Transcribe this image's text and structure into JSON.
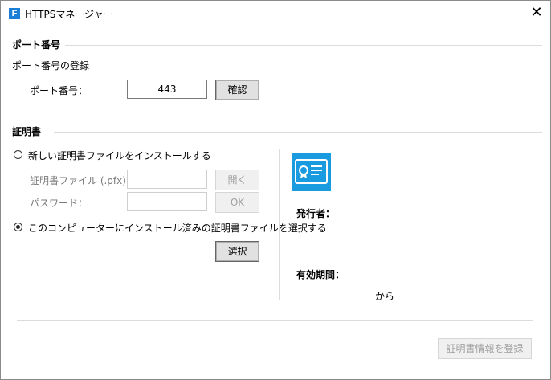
{
  "window": {
    "title": "HTTPSマネージャー",
    "app_icon_letter": "F",
    "close_glyph": "✕"
  },
  "port_section": {
    "title": "ポート番号",
    "subtitle": "ポート番号の登録",
    "port_label": "ポート番号：",
    "port_value": "443",
    "confirm_button": "確認"
  },
  "cert_section": {
    "title": "証明書",
    "option_install_label": "新しい証明書ファイルをインストールする",
    "option_install_selected": false,
    "cert_file_label": "証明書ファイル (.pfx)：",
    "cert_file_value": "",
    "open_button": "開く",
    "password_label": "パスワード：",
    "password_value": "",
    "ok_button": "OK",
    "option_select_label": "このコンピューターにインストール済みの証明書ファイルを選択する",
    "option_select_selected": true,
    "select_button": "選択"
  },
  "cert_info": {
    "icon": "certificate-icon",
    "icon_color": "#1a9be0",
    "issuer_label": "発行者：",
    "validity_label": "有効期間：",
    "from_text": "から"
  },
  "footer": {
    "register_button": "証明書情報を登録"
  }
}
